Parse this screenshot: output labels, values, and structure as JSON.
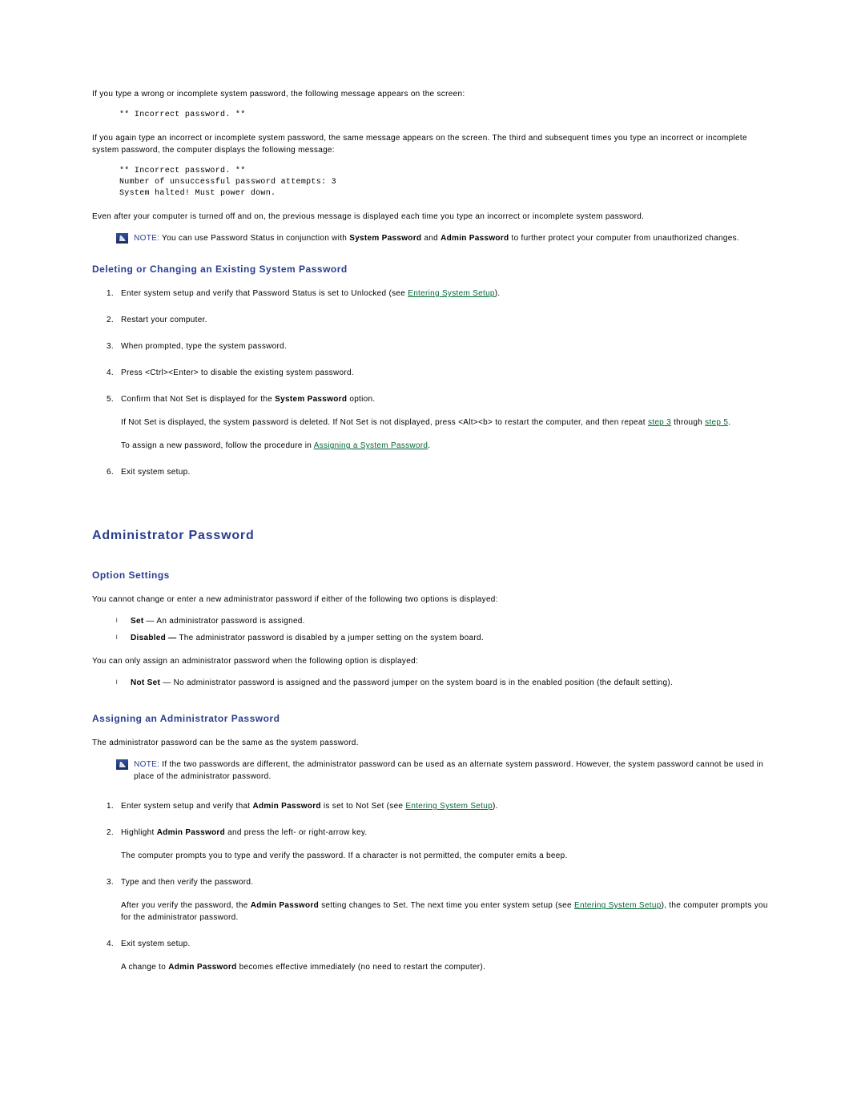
{
  "intro": {
    "p1": "If you type a wrong or incomplete system password, the following message appears on the screen:",
    "pre1": "** Incorrect password. **",
    "p2": "If you again type an incorrect or incomplete system password, the same message appears on the screen. The third and subsequent times you type an incorrect or incomplete system password, the computer displays the following message:",
    "pre2": "** Incorrect password. **\nNumber of unsuccessful password attempts: 3\nSystem halted! Must power down.",
    "p3": "Even after your computer is turned off and on, the previous message is displayed each time you type an incorrect or incomplete system password."
  },
  "note1": {
    "label": "NOTE:",
    "text_a": " You can use Password Status in conjunction with ",
    "b1": "System Password",
    "text_b": " and ",
    "b2": "Admin Password",
    "text_c": " to further protect your computer from unauthorized changes."
  },
  "delchg": {
    "heading": "Deleting or Changing an Existing System Password",
    "li1_a": "Enter system setup and verify that Password Status is set to Unlocked (see ",
    "li1_link": "Entering System Setup",
    "li1_b": ").",
    "li2": "Restart your computer.",
    "li3": "When prompted, type the system password.",
    "li4": "Press <Ctrl><Enter> to disable the existing system password.",
    "li5_a": "Confirm that Not Set is displayed for the ",
    "li5_bold": "System Password",
    "li5_b": " option.",
    "li5_p_a": "If Not Set is displayed, the system password is deleted. If Not Set is not displayed, press <Alt><b> to restart the computer, and then repeat ",
    "li5_link1": "step 3",
    "li5_p_b": " through ",
    "li5_link2": "step 5",
    "li5_p_c": ".",
    "li5_p2_a": "To assign a new password, follow the procedure in ",
    "li5_link3": "Assigning a System Password",
    "li5_p2_b": ".",
    "li6": "Exit system setup."
  },
  "admin": {
    "heading": "Administrator Password",
    "opt_heading": "Option Settings",
    "opt_p1": "You cannot change or enter a new administrator password if either of the following two options is displayed:",
    "opt_b1_a": "Set",
    "opt_b1_b": " — An administrator password is assigned.",
    "opt_b2_a": "Disabled —",
    "opt_b2_b": " The administrator password is disabled by a jumper setting on the system board.",
    "opt_p2": "You can only assign an administrator password when the following option is displayed:",
    "opt_b3_a": "Not Set",
    "opt_b3_b": " — No administrator password is assigned and the password jumper on the system board is in the enabled position (the default setting).",
    "assign_heading": "Assigning an Administrator Password",
    "assign_p1": "The administrator password can be the same as the system password.",
    "note2_label": "NOTE:",
    "note2_text": " If the two passwords are different, the administrator password can be used as an alternate system password. However, the system password cannot be used in place of the administrator password.",
    "a_li1_a": "Enter system setup and verify that ",
    "a_li1_bold": "Admin Password",
    "a_li1_b": " is set to Not Set (see ",
    "a_li1_link": "Entering System Setup",
    "a_li1_c": ").",
    "a_li2_a": "Highlight ",
    "a_li2_bold": "Admin Password",
    "a_li2_b": " and press the left- or right-arrow key.",
    "a_li2_p": "The computer prompts you to type and verify the password. If a character is not permitted, the computer emits a beep.",
    "a_li3": "Type and then verify the password.",
    "a_li3_p_a": "After you verify the password, the ",
    "a_li3_bold": "Admin Password",
    "a_li3_p_b": " setting changes to Set. The next time you enter system setup (see ",
    "a_li3_link": "Entering System Setup",
    "a_li3_p_c": "), the computer prompts you for the administrator password.",
    "a_li4": "Exit system setup.",
    "a_li4_p_a": "A change to ",
    "a_li4_bold": "Admin Password",
    "a_li4_p_b": " becomes effective immediately (no need to restart the computer)."
  }
}
